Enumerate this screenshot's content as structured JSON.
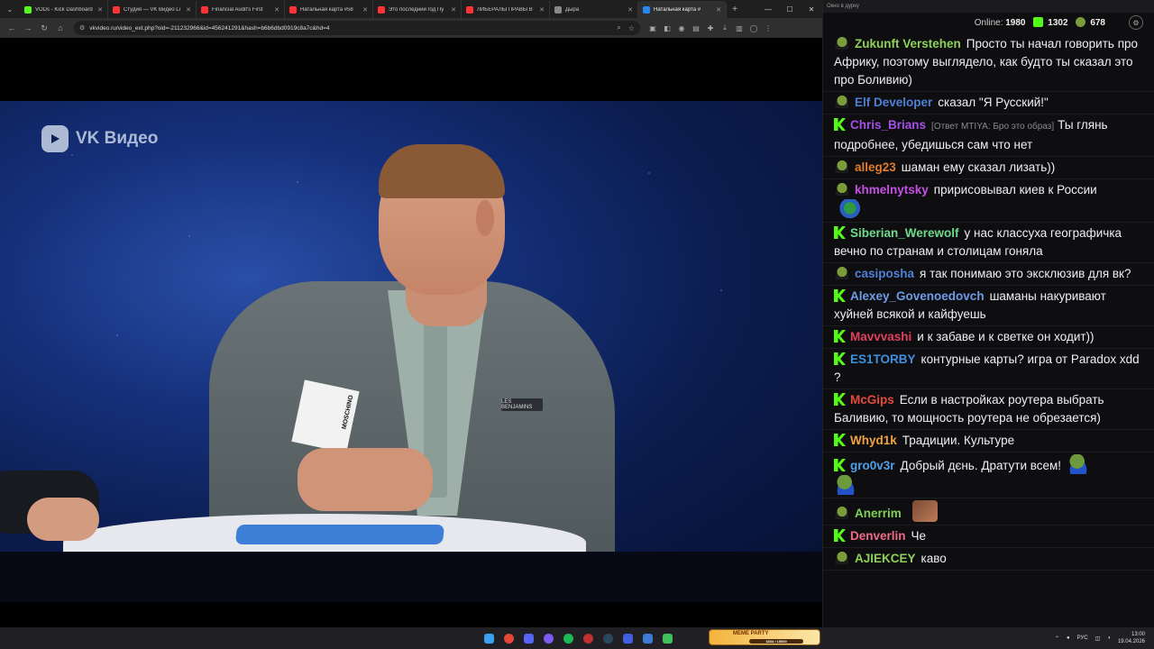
{
  "browser": {
    "tabs": [
      {
        "label": "VODs - Kick Dashboard",
        "color": "#53fc18",
        "active": false
      },
      {
        "label": "Студия — VK Видео Li",
        "color": "#ff3333",
        "active": false
      },
      {
        "label": "Financial Audit's First",
        "color": "#ff3333",
        "active": false
      },
      {
        "label": "Натальная карта #58",
        "color": "#ff3333",
        "active": false
      },
      {
        "label": "Это последний год Пу",
        "color": "#ff3333",
        "active": false
      },
      {
        "label": "ЛИБЕРАЛЫ ПРАВЫ В",
        "color": "#ff3333",
        "active": false
      },
      {
        "label": "Дыра",
        "color": "#888888",
        "active": false
      },
      {
        "label": "Натальная карта #",
        "color": "#2787f5",
        "active": true
      }
    ],
    "url": "vkvideo.ru/video_ext.php?oid=-211232966&id=456241291&hash=b6b6dbd0919c8a7c&hd=4"
  },
  "video": {
    "watermark": "VK Видео",
    "badge_text": "LES BENJAMINS",
    "pocket_text": "MOSCHINO"
  },
  "chat": {
    "topbar": "Окно в дурку",
    "online_label": "Online:",
    "online_count": "1980",
    "kick_count": "1302",
    "pepe_count": "678",
    "messages": [
      {
        "user": "Zukunft Verstehen",
        "color": "#8fd158",
        "badge": "pepe",
        "text": "Просто ты начал говорить про Африку, поэтому выглядело, как будто ты сказал это про Боливию)"
      },
      {
        "user": "Elf Developer",
        "color": "#4e7fd6",
        "badge": "pepe",
        "text": "сказал \"Я Русский!\""
      },
      {
        "user": "Chris_Brians",
        "color": "#a34fe8",
        "badge": "k",
        "reply": "[Ответ MTIYA: Бро это образ]",
        "text": "Ты глянь подробнее, убедишься сам что нет"
      },
      {
        "user": "alleg23",
        "color": "#e07b2f",
        "badge": "pepe",
        "text": "шаман ему сказал лизать))"
      },
      {
        "user": "khmelnytsky",
        "color": "#c64fe8",
        "badge": "pepe",
        "text": "пририсовывал киев к России",
        "emote": "globe"
      },
      {
        "user": "Siberian_Werewolf",
        "color": "#6ddc8a",
        "badge": "k",
        "text": "у нас классуха географичка вечно по странам и столицам гоняла"
      },
      {
        "user": "casiposha",
        "color": "#4e7fd6",
        "badge": "pepe",
        "text": "я так понимаю это эксклюзив для вк?"
      },
      {
        "user": "Alexey_Govenoedovch",
        "color": "#6f9be8",
        "badge": "k",
        "text": "шаманы накуривают хуйней всякой и кайфуешь"
      },
      {
        "user": "Mavvvashi",
        "color": "#e0405f",
        "badge": "k",
        "text": "и к забаве и к светке он ходит))"
      },
      {
        "user": "ES1TORBY",
        "color": "#3f8fe0",
        "badge": "k",
        "text": "контурные карты? игра от Paradox xdd ?"
      },
      {
        "user": "McGips",
        "color": "#e64a3a",
        "badge": "k",
        "text": "Если в настройках роутера выбрать Баливию, то мощность роутера не обрезается)"
      },
      {
        "user": "Whyd1k",
        "color": "#f0a340",
        "badge": "k",
        "text": "Традиции. Культуре"
      },
      {
        "user": "gro0v3r",
        "color": "#4ea0e8",
        "badge": "k",
        "text": "Добрый дєнь. Дратути всем!",
        "emote": "pepe",
        "emote2": "pepe"
      },
      {
        "user": "Anerrim",
        "color": "#7fd158",
        "badge": "pepe",
        "text": "",
        "emote": "photo"
      },
      {
        "user": "Denverlin",
        "color": "#f06b8a",
        "badge": "k",
        "text": "Че"
      },
      {
        "user": "AJIEKCEY",
        "color": "#8fd158",
        "badge": "pepe",
        "text": "каво"
      }
    ]
  },
  "taskbar": {
    "meme_title": "MEME PARTY",
    "meme_progress": "1834 / 15000",
    "lang": "РУС",
    "time": "13:00",
    "date": "19.04.2026"
  }
}
